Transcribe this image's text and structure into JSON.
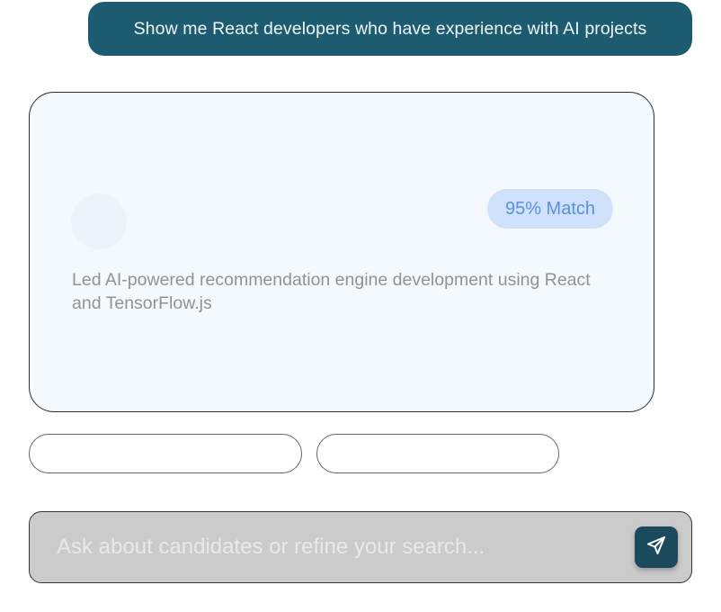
{
  "chat": {
    "user_message": "Show me React developers who have experience with AI projects"
  },
  "candidate_card": {
    "match_badge": "95% Match",
    "summary": "Led AI-powered recommendation engine development using React and TensorFlow.js"
  },
  "input": {
    "placeholder": "Ask about candidates or refine your search..."
  },
  "icons": {
    "send": "send-icon"
  },
  "colors": {
    "user_bubble": "#1d5c70",
    "send_button": "#1a4a5c",
    "match_badge_bg": "#cfe1fb",
    "match_badge_text": "#5b8fe0",
    "card_bg": "#f4f9fd",
    "input_bg": "#cbcbcb"
  }
}
